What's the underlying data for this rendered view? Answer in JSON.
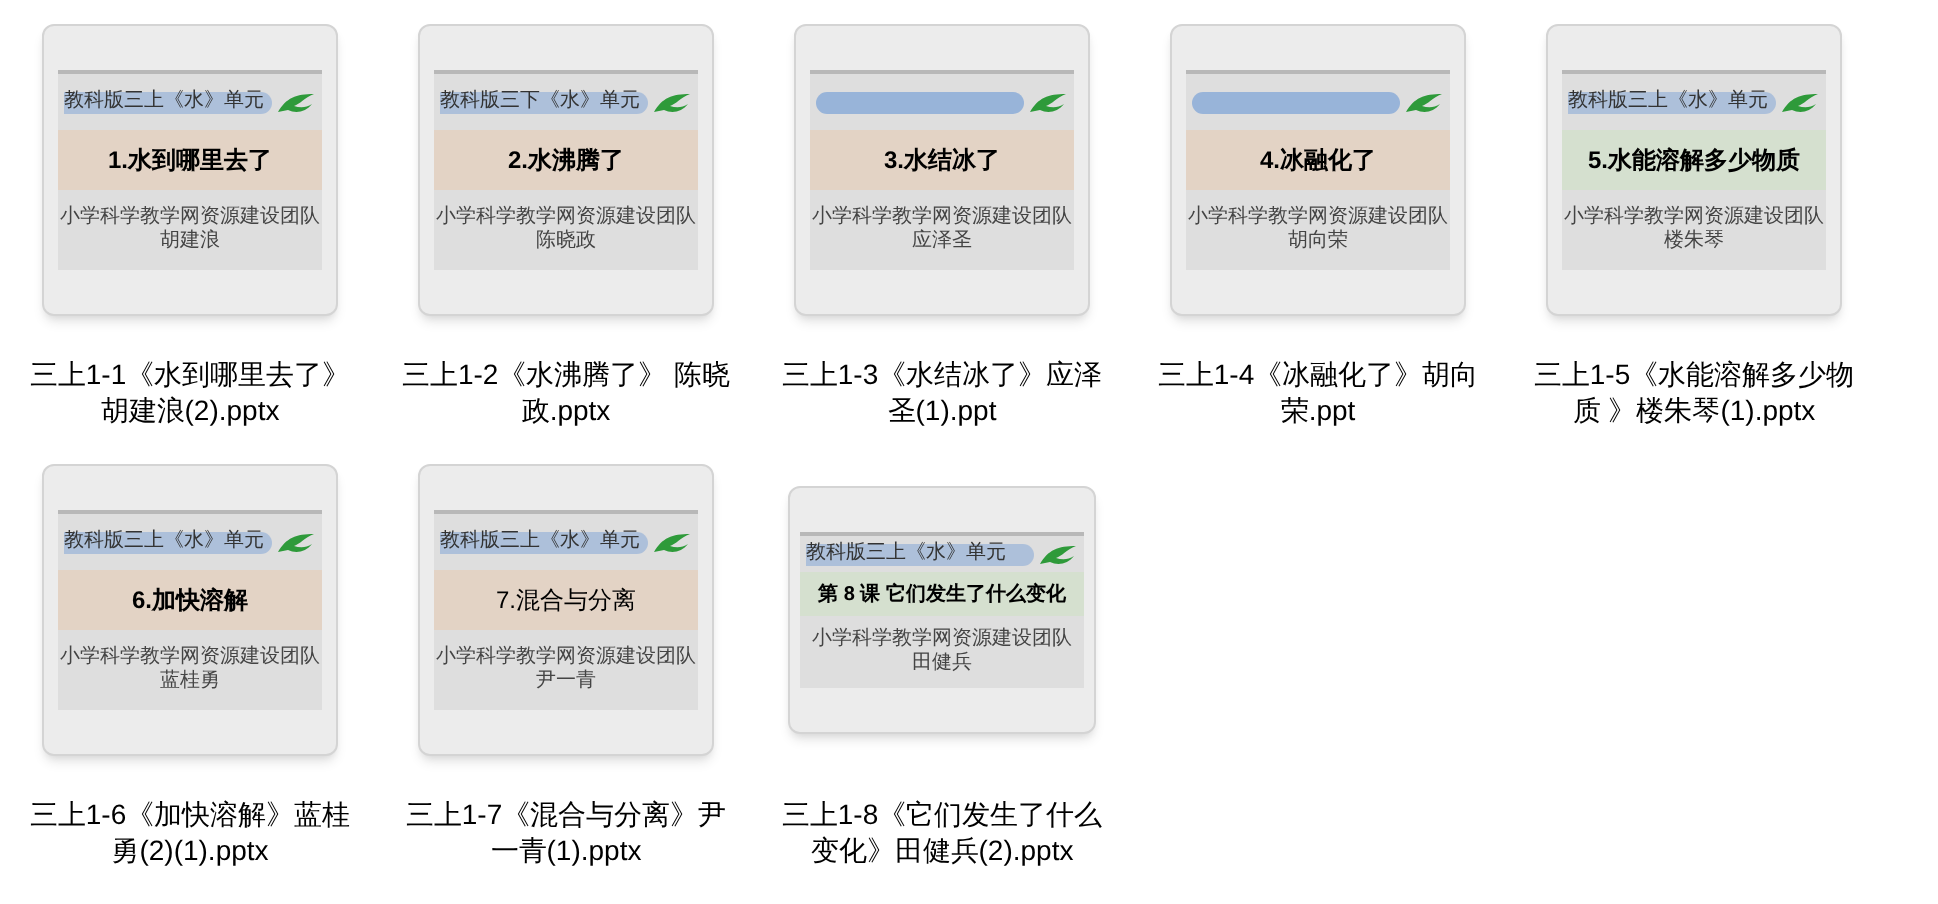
{
  "files": [
    {
      "kind": "standard",
      "slide": {
        "header": "教科版三上《水》单元",
        "title": "1.水到哪里去了",
        "bold": true,
        "color": "#e3d3c5",
        "team": "小学科学教学网资源建设团队",
        "author": "胡建浪"
      },
      "label_lines": [
        "三上1-1《水到哪里去了》",
        "胡建浪(2).pptx"
      ]
    },
    {
      "kind": "standard",
      "slide": {
        "header": "教科版三下《水》单元",
        "title": "2.水沸腾了",
        "bold": true,
        "color": "#e3d3c5",
        "team": "小学科学教学网资源建设团队",
        "author": "陈晓政"
      },
      "label_lines": [
        "三上1-2《水沸腾了》 陈晓",
        "政.pptx"
      ]
    },
    {
      "kind": "standard",
      "slide": {
        "title": "3.水结冰了",
        "bold": true,
        "color": "#e3d3c5",
        "team": "小学科学教学网资源建设团队",
        "author": "应泽圣"
      },
      "label_lines": [
        "三上1-3《水结冰了》应泽",
        "圣(1).ppt"
      ]
    },
    {
      "kind": "standard",
      "slide": {
        "title": "4.冰融化了",
        "bold": true,
        "color": "#e3d3c5",
        "team": "小学科学教学网资源建设团队",
        "author": "胡向荣"
      },
      "label_lines": [
        "三上1-4《冰融化了》胡向",
        "荣.ppt"
      ]
    },
    {
      "kind": "standard",
      "slide": {
        "header": "教科版三上《水》单元",
        "title": "5.水能溶解多少物质",
        "bold": true,
        "color": "#d5e0cf",
        "team": "小学科学教学网资源建设团队",
        "author": "楼朱琴"
      },
      "label_lines": [
        "三上1-5《水能溶解多少物",
        "质 》楼朱琴(1).pptx"
      ]
    },
    {
      "kind": "standard",
      "slide": {
        "header": "教科版三上《水》单元",
        "title": "6.加快溶解",
        "bold": true,
        "color": "#e3d3c5",
        "team": "小学科学教学网资源建设团队",
        "author": "蓝桂勇"
      },
      "label_lines": [
        "三上1-6《加快溶解》蓝桂",
        "勇(2)(1).pptx"
      ]
    },
    {
      "kind": "standard",
      "slide": {
        "header": "教科版三上《水》单元",
        "title": "7.混合与分离",
        "bold": false,
        "color": "#e3d3c5",
        "team": "小学科学教学网资源建设团队",
        "author": "尹一青"
      },
      "label_lines": [
        "三上1-7《混合与分离》尹",
        "一青(1).pptx"
      ]
    },
    {
      "kind": "wide",
      "slide": {
        "header": "教科版三上《水》单元",
        "title": "第 8 课 它们发生了什么变化",
        "bold": true,
        "color": "#d5e0cf",
        "team": "小学科学教学网资源建设团队",
        "author": "田健兵"
      },
      "label_lines": [
        "三上1-8《它们发生了什么",
        "变化》田健兵(2).pptx"
      ]
    }
  ]
}
